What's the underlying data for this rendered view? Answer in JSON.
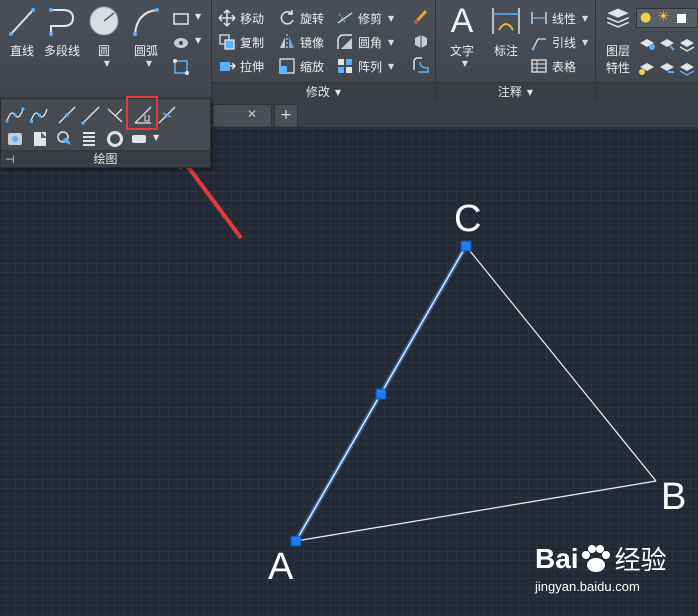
{
  "ribbon": {
    "draw": {
      "line": "直线",
      "polyline": "多段线",
      "circle": "圆",
      "arc": "圆弧",
      "footer": "绘图"
    },
    "modify": {
      "move": "移动",
      "rotate": "旋转",
      "trim": "修剪",
      "copy": "复制",
      "mirror": "镜像",
      "fillet": "圆角",
      "stretch": "拉伸",
      "scale": "缩放",
      "array": "阵列",
      "footer": "修改"
    },
    "annotation": {
      "text": "文字",
      "dimension": "标注",
      "linear": "线性",
      "leader": "引线",
      "table": "表格",
      "footer": "注释"
    },
    "layers": {
      "layer_properties_line1": "图层",
      "layer_properties_line2": "特性"
    }
  },
  "drawing": {
    "points": {
      "A": "A",
      "B": "B",
      "C": "C"
    }
  },
  "watermark": {
    "brand_left": "Bai",
    "brand_right": "经验",
    "url": "jingyan.baidu.com"
  },
  "colors": {
    "canvas_bg": "#232a36",
    "selected_line": "#6ab0ff",
    "grip": "#1e7ef0",
    "highlight": "#e43b3b",
    "arrow": "#e23a3a"
  }
}
